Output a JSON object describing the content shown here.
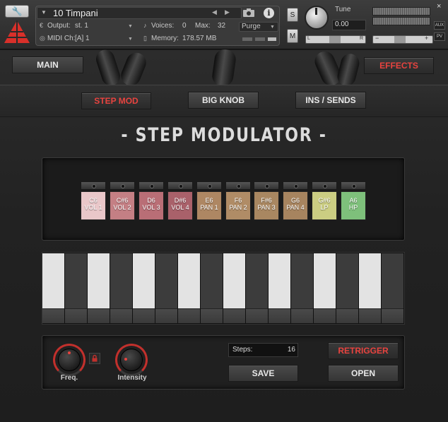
{
  "header": {
    "instrument_name": "10 Timpani",
    "output_label": "Output:",
    "output_value": "st. 1",
    "midi_label": "MIDI Ch:",
    "midi_value": "[A]  1",
    "voices_label": "Voices:",
    "voices_value": "0",
    "max_label": "Max:",
    "max_value": "32",
    "memory_label": "Memory:",
    "memory_value": "178.57 MB",
    "purge_label": "Purge",
    "solo_label": "S",
    "mute_label": "M",
    "tune_label": "Tune",
    "tune_value": "0.00",
    "pan_left": "L",
    "pan_right": "R",
    "aux_label": "AUX",
    "pv_label": "PV",
    "close_label": "×",
    "vol_minus": "−",
    "vol_plus": "+"
  },
  "nav": {
    "main_label": "MAIN",
    "effects_label": "EFFECTS"
  },
  "tabs": {
    "step_mod": "STEP MOD",
    "big_knob": "BIG KNOB",
    "ins_sends": "INS / SENDS"
  },
  "title": "- STEP MODULATOR -",
  "slots": [
    {
      "note": "C6",
      "target": "VOL 1",
      "color": "#e9c7c9"
    },
    {
      "note": "C#6",
      "target": "VOL 2",
      "color": "#c47f84"
    },
    {
      "note": "D6",
      "target": "VOL 3",
      "color": "#b96e76"
    },
    {
      "note": "D#6",
      "target": "VOL 4",
      "color": "#a9616a"
    },
    {
      "note": "E6",
      "target": "PAN 1",
      "color": "#ae8763"
    },
    {
      "note": "F6",
      "target": "PAN 2",
      "color": "#b08c66"
    },
    {
      "note": "F#6",
      "target": "PAN 3",
      "color": "#a98761"
    },
    {
      "note": "G6",
      "target": "PAN 4",
      "color": "#a7845f"
    },
    {
      "note": "G#6",
      "target": "LP",
      "color": "#cbcd82"
    },
    {
      "note": "A6",
      "target": "HP",
      "color": "#7ec07b"
    }
  ],
  "keyboard": {
    "key_tones": [
      "light",
      "dark",
      "light",
      "dark",
      "light",
      "dark",
      "light",
      "dark",
      "light",
      "dark",
      "light",
      "dark",
      "light",
      "dark",
      "light",
      "dark"
    ]
  },
  "controls": {
    "freq_label": "Freq.",
    "intensity_label": "Intensity",
    "steps_label": "Steps:",
    "steps_value": "16",
    "save_label": "SAVE",
    "retrigger_label": "RETRIGGER",
    "open_label": "OPEN"
  },
  "colors": {
    "accent_red": "#e8433f",
    "light_key": "#e3e3e3",
    "dark_key": "#3c3c3c"
  }
}
